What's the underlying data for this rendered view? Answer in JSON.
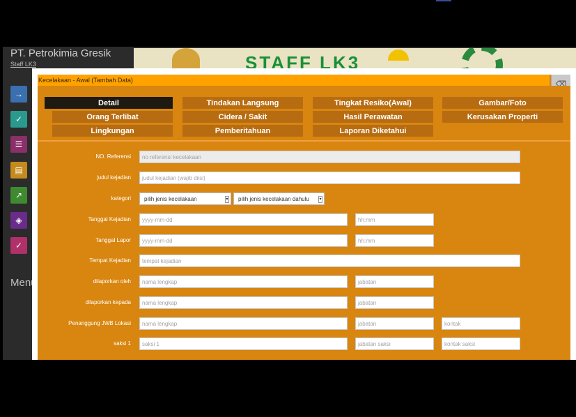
{
  "background": {
    "company": "PT. Petrokimia Gresik",
    "user": "Staff LK3",
    "menu_label": "Menu",
    "banner_text": "STAFF LK3",
    "menu_icons": [
      {
        "icon": "arrow-circle-icon",
        "color": "#3a6fb0"
      },
      {
        "icon": "calendar-check-icon",
        "color": "#2a9a8e"
      },
      {
        "icon": "list-icon",
        "color": "#8a2f6a"
      },
      {
        "icon": "folder-icon",
        "color": "#c48a1c"
      },
      {
        "icon": "chart-icon",
        "color": "#3f8a30"
      },
      {
        "icon": "box-icon",
        "color": "#6a2c8a"
      },
      {
        "icon": "calendar-check-icon",
        "color": "#b0306a"
      }
    ]
  },
  "modal": {
    "title": "Kecelakaan - Awal (Tambah Data)",
    "close_icon": "eraser-icon",
    "tabs": [
      [
        "Detail",
        "Tindakan Langsung",
        "Tingkat Resiko(Awal)",
        "Gambar/Foto"
      ],
      [
        "Orang Terlibat",
        "Cidera / Sakit",
        "Hasil Perawatan",
        "Kerusakan Properti"
      ],
      [
        "Lingkungan",
        "Pemberitahuan",
        "Laporan Diketahui"
      ]
    ],
    "form": {
      "ref_label": "NO. Referensi",
      "ref_placeholder": "no referensi kecelakaan",
      "judul_label": "judul kejadian",
      "judul_placeholder": "judul kejadian (wajib diisi)",
      "kategori_label": "kategori",
      "kategori_select1": "pilih jenis kecelakaan",
      "kategori_select2": "pilih jenis kecelakaan dahulu",
      "tgl_kejadian_label": "Tanggal Kejadian",
      "date_placeholder": "yyyy-mm-dd",
      "time_placeholder": "hh:mm",
      "tgl_lapor_label": "Tanggal Lapor",
      "tempat_label": "Tempat Kejadian",
      "tempat_placeholder": "tempat kejadian",
      "dilaporkan_oleh_label": "dilaporkan oleh",
      "dilaporkan_kepada_label": "dilaporkan kepada",
      "pj_label": "Penanggung JWB Lokasi",
      "nama_placeholder": "nama lengkap",
      "jabatan_placeholder": "jabatan",
      "kontak_placeholder": "kontak",
      "saksi_label": "saksi 1",
      "saksi_placeholder": "saksi 1",
      "jabatan_saksi_placeholder": "jabatan saksi",
      "kontak_saksi_placeholder": "kontak saksi"
    }
  },
  "colors": {
    "modal_bg": "#d8860f",
    "header_bg": "#ffa200",
    "tab_bg": "#b86c12",
    "tab_active": "#1e1a12"
  }
}
